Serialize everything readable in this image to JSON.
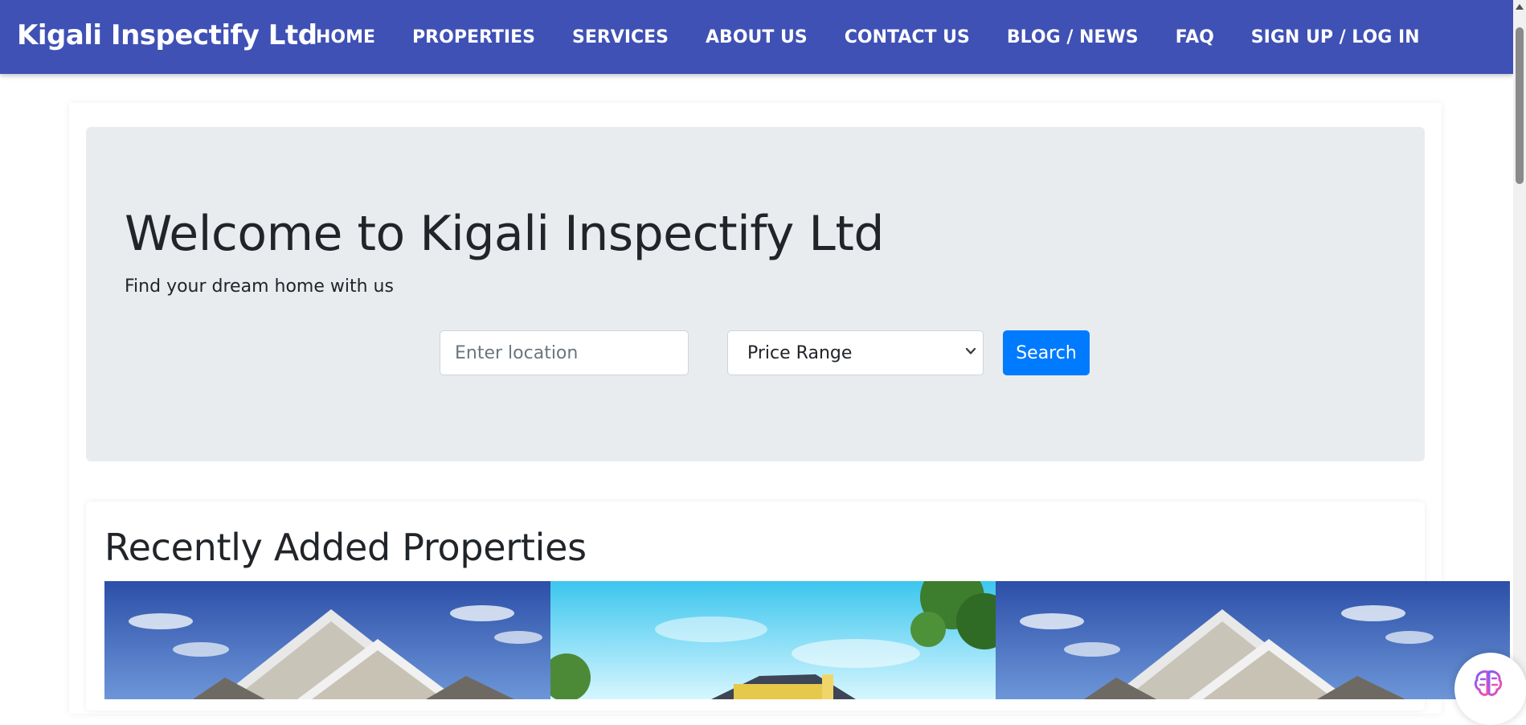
{
  "navbar": {
    "brand": "Kigali Inspectify Ltd",
    "links": [
      "HOME",
      "PROPERTIES",
      "SERVICES",
      "ABOUT US",
      "CONTACT US",
      "BLOG / NEWS",
      "FAQ",
      "SIGN UP / LOG IN"
    ],
    "background": "#3f51b5"
  },
  "hero": {
    "title": "Welcome to Kigali Inspectify Ltd",
    "subtitle": "Find your dream home with us",
    "background": "#e9ecef"
  },
  "search": {
    "location_placeholder": "Enter location",
    "price_selected": "Price Range",
    "button_label": "Search",
    "button_color": "#007bff"
  },
  "recent": {
    "title": "Recently Added Properties"
  },
  "icons": {
    "select_arrow": "chevron-down-icon",
    "assistant": "brain-icon"
  }
}
